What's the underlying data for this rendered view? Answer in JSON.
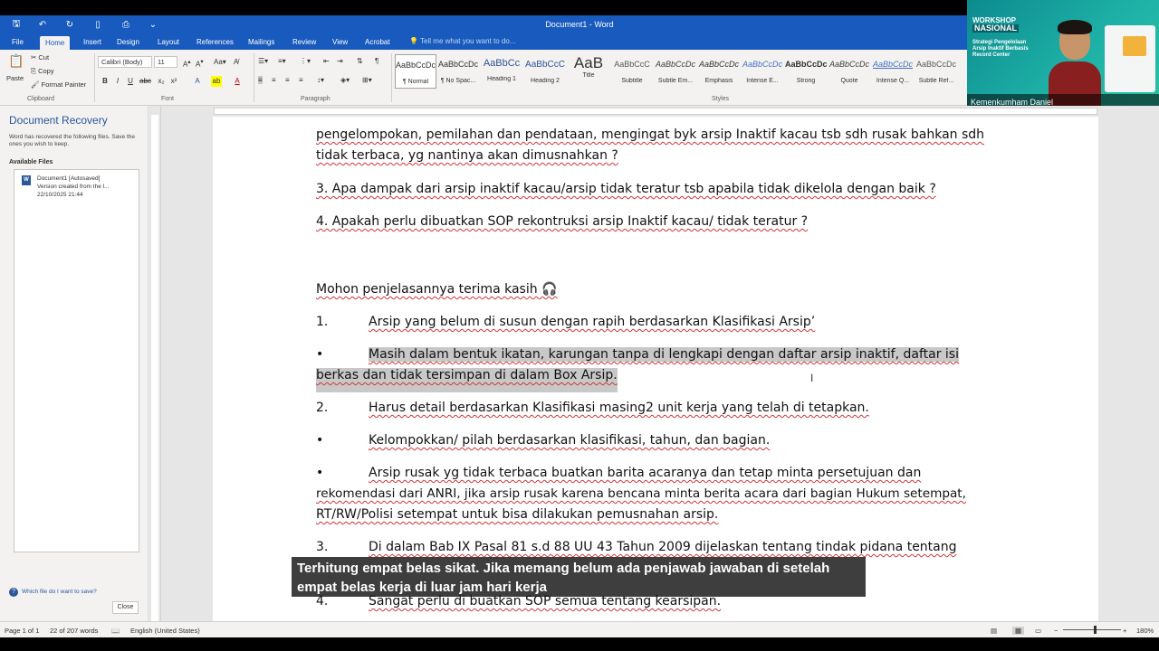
{
  "window": {
    "title": "Document1 - Word"
  },
  "tabs": [
    "File",
    "Home",
    "Insert",
    "Design",
    "Layout",
    "References",
    "Mailings",
    "Review",
    "View",
    "Acrobat"
  ],
  "tellme": "Tell me what you want to do...",
  "clipboard": {
    "paste": "Paste",
    "cut": "Cut",
    "copy": "Copy",
    "format_painter": "Format Painter",
    "label": "Clipboard"
  },
  "font": {
    "name": "Calibri (Body)",
    "size": "11",
    "label": "Font"
  },
  "paragraph": {
    "label": "Paragraph"
  },
  "styles": {
    "label": "Styles",
    "items": [
      {
        "sample": "AaBbCcDc",
        "name": "¶ Normal"
      },
      {
        "sample": "AaBbCcDc",
        "name": "¶ No Spac..."
      },
      {
        "sample": "AaBbCc",
        "name": "Heading 1"
      },
      {
        "sample": "AaBbCcC",
        "name": "Heading 2"
      },
      {
        "sample": "AaB",
        "name": "Title"
      },
      {
        "sample": "AaBbCcC",
        "name": "Subtitle"
      },
      {
        "sample": "AaBbCcDc",
        "name": "Subtle Em..."
      },
      {
        "sample": "AaBbCcDc",
        "name": "Emphasis"
      },
      {
        "sample": "AaBbCcDc",
        "name": "Intense E..."
      },
      {
        "sample": "AaBbCcDc",
        "name": "Strong"
      },
      {
        "sample": "AaBbCcDc",
        "name": "Quote"
      },
      {
        "sample": "AaBbCcDc",
        "name": "Intense Q..."
      },
      {
        "sample": "AaBbCcDc",
        "name": "Subtle Ref..."
      }
    ]
  },
  "webcam": {
    "banner_line1": "WORKSHOP",
    "banner_line2": "NASIONAL",
    "banner_sub": "Strategi Pengelolaan Arsip Inaktif Berbasis Record Center",
    "name": "Kemenkumham Daniel"
  },
  "recovery": {
    "title": "Document Recovery",
    "desc": "Word has recovered the following files. Save the ones you wish to keep.",
    "available": "Available Files",
    "file_name": "Document1 [Autosaved]",
    "file_info": "Version created from the l...",
    "file_date": "22/10/2025 21:44",
    "help": "Which file do I want to save?",
    "close": "Close"
  },
  "document": {
    "p0_line1": "pengelompokan, pemilahan dan pendataan, mengingat byk arsip Inaktif kacau tsb sdh rusak bahkan sdh",
    "p0_line2": "tidak terbaca, yg nantinya akan dimusnahkan ?",
    "p3": "3. Apa dampak dari arsip inaktif kacau/arsip tidak teratur tsb apabila tidak dikelola dengan baik ?",
    "p4": "4. Apakah perlu dibuatkan SOP rekontruksi arsip Inaktif kacau/ tidak teratur ?",
    "thanks": "Mohon penjelasannya terima kasih 🎧",
    "a1_num": "1.",
    "a1": "Arsip yang belum di susun dengan rapih berdasarkan Klasifikasi Arsip’",
    "b1_bullet": "•",
    "b1_line1": "Masih dalam bentuk ikatan, karungan tanpa di lengkapi dengan daftar arsip inaktif, daftar isi",
    "b1_line2": "berkas dan tidak tersimpan di dalam Box Arsip.",
    "a2_num": "2.",
    "a2": "Harus detail berdasarkan Klasifikasi masing2 unit kerja yang telah di tetapkan.",
    "b2_bullet": "•",
    "b2": "Kelompokkan/ pilah berdasarkan klasifikasi, tahun, dan bagian.",
    "b3_bullet": "•",
    "b3_line1": "Arsip rusak yg tidak terbaca buatkan barita acaranya dan tetap minta persetujuan dan",
    "b3_line2": "rekomendasi dari ANRI, jika arsip rusak karena bencana minta berita acara dari bagian Hukum setempat,",
    "b3_line3": "RT/RW/Polisi setempat untuk bisa dilakukan pemusnahan arsip.",
    "a3_num": "3.",
    "a3": "Di dalam Bab IX Pasal 81 s.d 88 UU 43 Tahun 2009 dijelaskan tentang tindak pidana tentang",
    "a4_num": "4.",
    "a4": "Sangat perlu di buatkan SOP semua tentang kearsipan."
  },
  "subtitle": {
    "line1": "Terhitung empat belas sikat. Jika memang belum ada penjawab jawaban di setelah",
    "line2": "empat belas kerja di luar jam hari kerja"
  },
  "status": {
    "page": "Page 1 of 1",
    "words": "22 of 207 words",
    "language": "English (United States)",
    "zoom": "180%"
  }
}
